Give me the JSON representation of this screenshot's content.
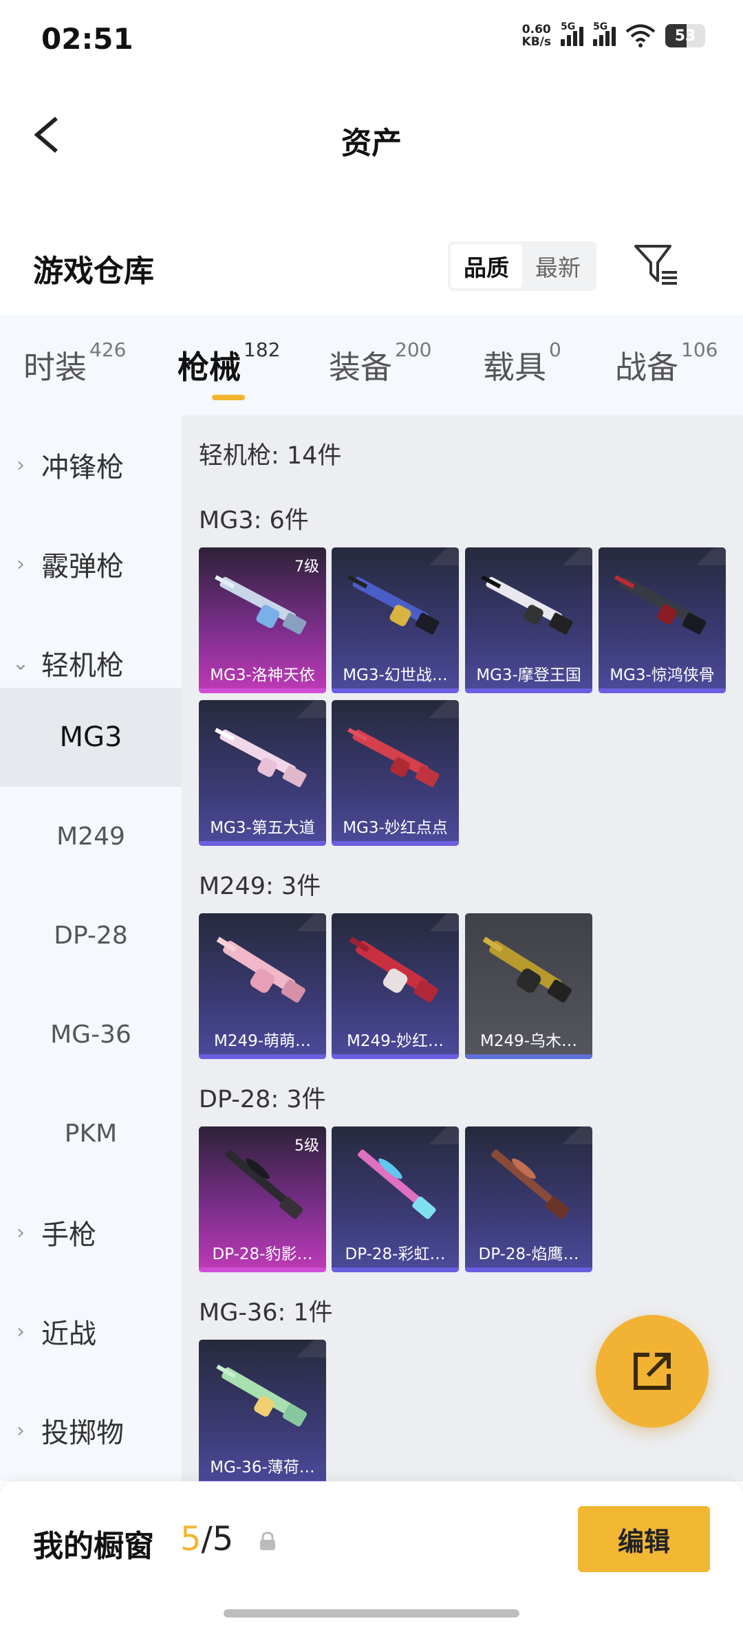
{
  "status": {
    "time": "02:51",
    "speed_value": "0.60",
    "speed_unit": "KB/s",
    "net1": "5G",
    "net2": "5G",
    "battery": "53"
  },
  "header": {
    "title": "资产"
  },
  "warehouse": {
    "title": "游戏仓库",
    "sort_options": [
      "品质",
      "最新"
    ],
    "sort_selected": "品质"
  },
  "tabs": [
    {
      "label": "时装",
      "count": "426"
    },
    {
      "label": "枪械",
      "count": "182",
      "active": true
    },
    {
      "label": "装备",
      "count": "200"
    },
    {
      "label": "载具",
      "count": "0"
    },
    {
      "label": "战备",
      "count": "106"
    }
  ],
  "sidebar": {
    "items": [
      {
        "label": "冲锋枪",
        "expanded": false
      },
      {
        "label": "霰弹枪",
        "expanded": false
      },
      {
        "label": "轻机枪",
        "expanded": true
      },
      {
        "label": "MG3",
        "sub": true,
        "selected": true
      },
      {
        "label": "M249",
        "sub": true
      },
      {
        "label": "DP-28",
        "sub": true
      },
      {
        "label": "MG-36",
        "sub": true
      },
      {
        "label": "PKM",
        "sub": true
      },
      {
        "label": "手枪",
        "expanded": false
      },
      {
        "label": "近战",
        "expanded": false
      },
      {
        "label": "投掷物",
        "expanded": false
      }
    ]
  },
  "content": {
    "category_label": "轻机枪: 14件",
    "groups": [
      {
        "label": "MG3: 6件",
        "items": [
          {
            "name": "MG3-洛神天依",
            "level": "7级",
            "rarity": "pink"
          },
          {
            "name": "MG3-幻世战…",
            "rarity": "purple"
          },
          {
            "name": "MG3-摩登王国",
            "rarity": "purple"
          },
          {
            "name": "MG3-惊鸿侠骨",
            "rarity": "purple"
          },
          {
            "name": "MG3-第五大道",
            "rarity": "purple"
          },
          {
            "name": "MG3-妙红点点",
            "rarity": "purple"
          }
        ]
      },
      {
        "label": "M249: 3件",
        "items": [
          {
            "name": "M249-萌萌…",
            "rarity": "purple"
          },
          {
            "name": "M249-妙红…",
            "rarity": "purple"
          },
          {
            "name": "M249-乌木…",
            "rarity": "gray"
          }
        ]
      },
      {
        "label": "DP-28: 3件",
        "items": [
          {
            "name": "DP-28-豹影…",
            "level": "5级",
            "rarity": "pink"
          },
          {
            "name": "DP-28-彩虹…",
            "rarity": "purple"
          },
          {
            "name": "DP-28-焰鹰…",
            "rarity": "purple"
          }
        ]
      },
      {
        "label": "MG-36: 1件",
        "items": [
          {
            "name": "MG-36-薄荷…",
            "rarity": "purple"
          }
        ]
      }
    ]
  },
  "showcase": {
    "label": "我的橱窗",
    "count_current": "5",
    "count_sep": "/",
    "count_total": "5",
    "edit_label": "编辑"
  },
  "colors": {
    "accent": "#f2b530",
    "pink_rarity": "#d04ed6",
    "purple_rarity": "#6b5ee0"
  }
}
